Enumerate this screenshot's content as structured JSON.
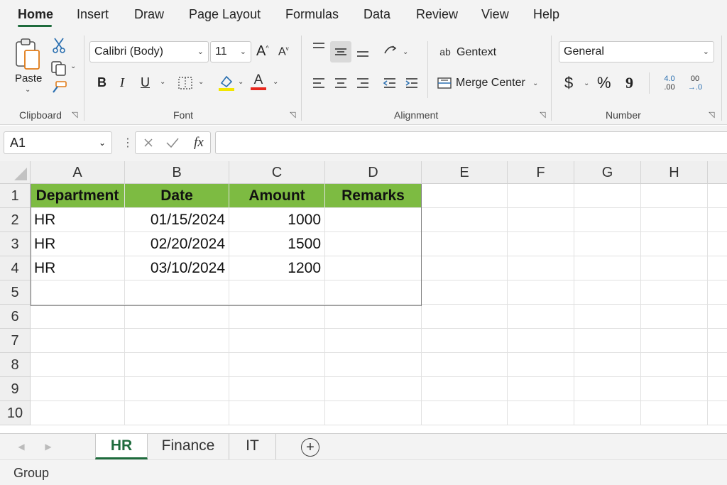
{
  "menu": {
    "tabs": [
      "Home",
      "Insert",
      "Draw",
      "Page Layout",
      "Formulas",
      "Data",
      "Review",
      "View",
      "Help"
    ],
    "active": "Home"
  },
  "ribbon": {
    "clipboard": {
      "paste_label": "Paste",
      "group_label": "Clipboard"
    },
    "font": {
      "font_name": "Calibri (Body)",
      "font_size": "11",
      "grow_label": "A",
      "shrink_label": "A",
      "bold": "B",
      "italic": "I",
      "underline": "U",
      "font_color_letter": "A",
      "group_label": "Font",
      "fill_color": "#f2e600",
      "font_color": "#e8281e"
    },
    "alignment": {
      "wrap_label": "Gentext",
      "wrap_prefix": "ab",
      "merge_label": "Merge Center",
      "group_label": "Alignment"
    },
    "number": {
      "format": "General",
      "currency": "$",
      "percent": "%",
      "comma": "9",
      "inc_decimal_top": "4.0",
      "inc_decimal_bottom": ".00",
      "dec_decimal_top": "00",
      "dec_decimal_bottom": "→.0",
      "group_label": "Number"
    }
  },
  "formula_bar": {
    "name_box": "A1",
    "fx": "fx",
    "value": ""
  },
  "sheet": {
    "columns": [
      "A",
      "B",
      "C",
      "D",
      "E",
      "F",
      "G",
      "H"
    ],
    "rows": [
      "1",
      "2",
      "3",
      "4",
      "5",
      "6",
      "7",
      "8",
      "9",
      "10"
    ],
    "header": [
      "Department",
      "Date",
      "Amount",
      "Remarks"
    ],
    "data": [
      [
        "HR",
        "01/15/2024",
        "1000",
        ""
      ],
      [
        "HR",
        "02/20/2024",
        "1500",
        ""
      ],
      [
        "HR",
        "03/10/2024",
        "1200",
        ""
      ]
    ],
    "header_fill": "#7dbb42"
  },
  "sheet_tabs": {
    "tabs": [
      "HR",
      "Finance",
      "IT"
    ],
    "active": "HR",
    "add_label": "+"
  },
  "status": {
    "text": "Group"
  },
  "colors": {
    "accent": "#1e6b3c"
  }
}
